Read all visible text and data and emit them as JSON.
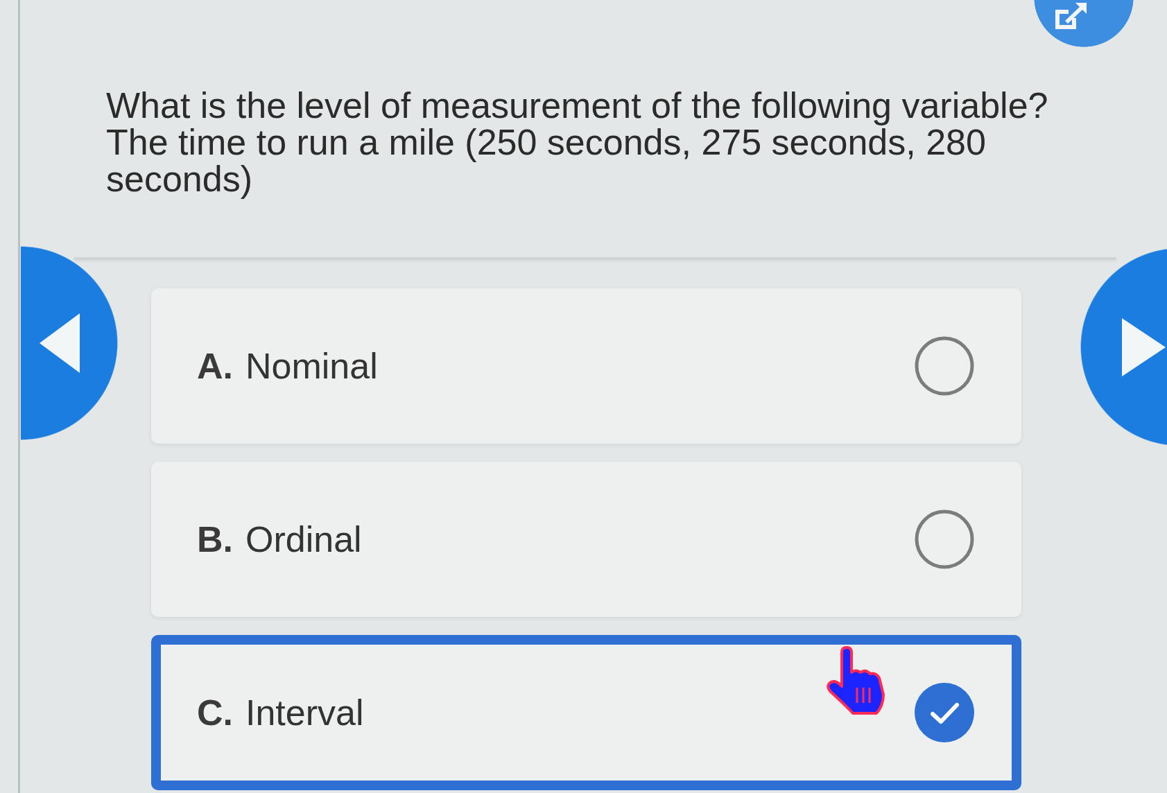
{
  "question": {
    "prompt": "What is the level of measurement of the following variable?",
    "detail": "The time to run a mile (250 seconds, 275 seconds, 280 seconds)"
  },
  "options": [
    {
      "letter": "A.",
      "label": "Nominal",
      "selected": false
    },
    {
      "letter": "B.",
      "label": "Ordinal",
      "selected": false
    },
    {
      "letter": "C.",
      "label": "Interval",
      "selected": true
    }
  ]
}
